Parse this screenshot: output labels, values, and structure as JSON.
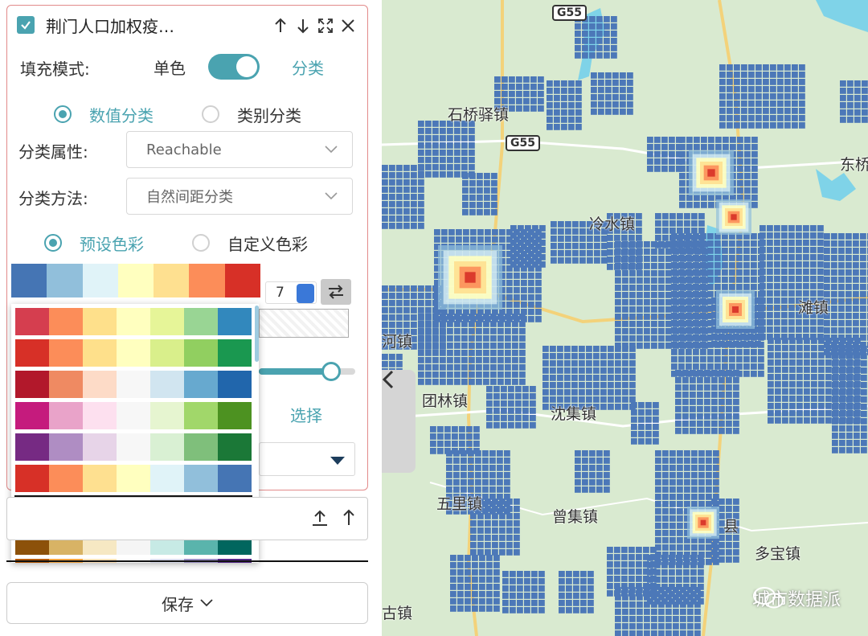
{
  "layer": {
    "title": "荆门人口加权疫…",
    "checked": true
  },
  "fill_mode": {
    "label": "填充模式:",
    "single_label": "单色",
    "class_label": "分类"
  },
  "classify": {
    "numeric_label": "数值分类",
    "category_label": "类别分类",
    "attr_label": "分类属性:",
    "attr_value": "Reachable",
    "method_label": "分类方法:",
    "method_value": "自然间距分类"
  },
  "colors": {
    "preset_label": "预设色彩",
    "custom_label": "自定义色彩",
    "class_count": "7",
    "current_palette": [
      "#4575b4",
      "#91bfdb",
      "#e0f3f8",
      "#ffffbf",
      "#fee090",
      "#fc8d59",
      "#d73027"
    ],
    "palettes": [
      [
        "#d53e4f",
        "#fc8d59",
        "#fee08b",
        "#ffffbf",
        "#e6f598",
        "#99d594",
        "#3288bd"
      ],
      [
        "#d73027",
        "#fc8d59",
        "#fee08b",
        "#ffffbf",
        "#d9ef8b",
        "#91cf60",
        "#1a9850"
      ],
      [
        "#b2182b",
        "#ef8a62",
        "#fddbc7",
        "#f7f7f7",
        "#d1e5f0",
        "#67a9cf",
        "#2166ac"
      ],
      [
        "#c51b7d",
        "#e9a3c9",
        "#fde0ef",
        "#f7f7f7",
        "#e6f5d0",
        "#a1d76a",
        "#4d9221"
      ],
      [
        "#762a83",
        "#af8dc3",
        "#e7d4e8",
        "#f7f7f7",
        "#d9f0d3",
        "#7fbf7b",
        "#1b7837"
      ],
      [
        "#d73027",
        "#fc8d59",
        "#fee090",
        "#ffffbf",
        "#e0f3f8",
        "#91bfdb",
        "#4575b4"
      ],
      [
        "#4575b4",
        "#91bfdb",
        "#e0f3f8",
        "#ffffbf",
        "#fee090",
        "#fc8d59",
        "#d73027"
      ],
      [
        "#8c510a",
        "#d8b365",
        "#f6e8c3",
        "#f5f5f5",
        "#c7eae5",
        "#5ab4ac",
        "#01665e"
      ],
      [
        "#b35806",
        "#f1a340",
        "#fee0b6",
        "#f7f7f7",
        "#d8daeb",
        "#998ec3",
        "#542788"
      ]
    ],
    "selected_index": 6
  },
  "choose_label": "选择",
  "save_label": "保存",
  "map": {
    "labels": [
      {
        "text": "石桥驿镇"
      },
      {
        "text": "东桥"
      },
      {
        "text": "冷水镇"
      },
      {
        "text": "河镇"
      },
      {
        "text": "团林镇"
      },
      {
        "text": "沈集镇"
      },
      {
        "text": "五里镇"
      },
      {
        "text": "曾集镇"
      },
      {
        "text": "多宝镇"
      },
      {
        "text": "古镇"
      },
      {
        "text": "滩镇"
      },
      {
        "text": "县"
      }
    ],
    "highways": [
      "G55",
      "G55"
    ],
    "watermark": "城市数据派"
  }
}
